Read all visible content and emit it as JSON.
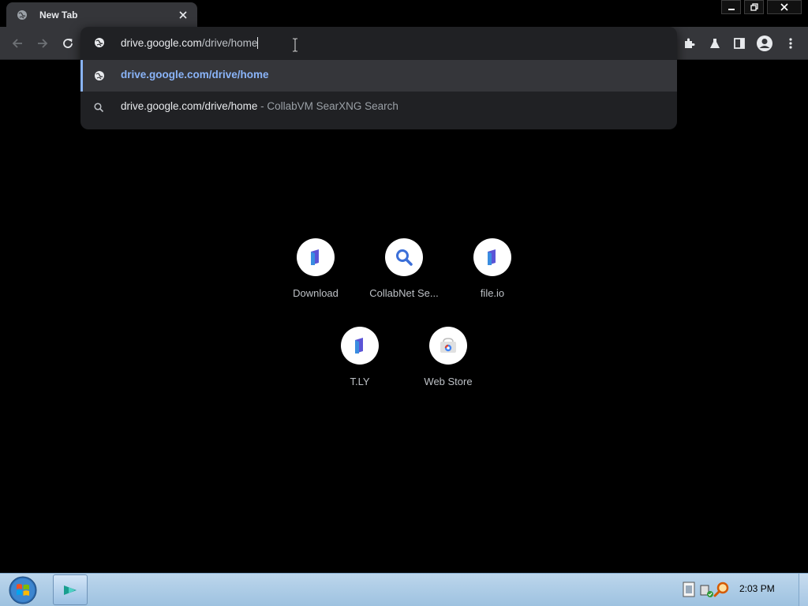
{
  "tab": {
    "title": "New Tab",
    "favicon": "globe-icon",
    "close_icon": "close-icon"
  },
  "omnibox": {
    "typed_bold": "drive.google.com",
    "typed_rest": "/drive/home",
    "suggestions": [
      {
        "text": "drive.google.com/drive/home",
        "icon": "globe-icon",
        "selected": true
      },
      {
        "main": "drive.google.com/drive/home",
        "separator": " - ",
        "description": "CollabVM SearXNG Search",
        "icon": "search-icon"
      }
    ]
  },
  "shortcuts": [
    {
      "label": "Download",
      "icon": "bookmark-tile-icon"
    },
    {
      "label": "CollabNet Se...",
      "icon": "search-icon"
    },
    {
      "label": "file.io",
      "icon": "bookmark-tile-icon"
    },
    {
      "label": "T.LY",
      "icon": "bookmark-tile-icon"
    },
    {
      "label": "Web Store",
      "icon": "web-store-icon"
    }
  ],
  "taskbar": {
    "clock": "2:03 PM"
  },
  "colors": {
    "accent": "#8ab4f8",
    "toolbar": "#35363a",
    "omnibox": "#202124",
    "background": "#000000"
  }
}
